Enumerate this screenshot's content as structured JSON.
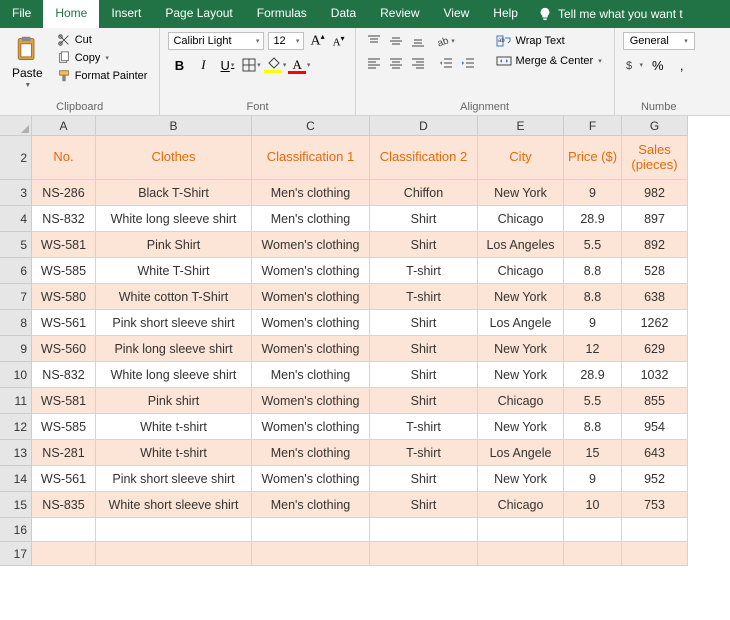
{
  "tabs": {
    "file": "File",
    "home": "Home",
    "insert": "Insert",
    "page_layout": "Page Layout",
    "formulas": "Formulas",
    "data": "Data",
    "review": "Review",
    "view": "View",
    "help": "Help",
    "tell_me": "Tell me what you want t"
  },
  "ribbon": {
    "clipboard": {
      "paste": "Paste",
      "cut": "Cut",
      "copy": "Copy",
      "format_painter": "Format Painter",
      "label": "Clipboard"
    },
    "font": {
      "name": "Calibri Light",
      "size": "12",
      "label": "Font"
    },
    "alignment": {
      "wrap": "Wrap Text",
      "merge": "Merge & Center",
      "label": "Alignment"
    },
    "number": {
      "format": "General",
      "label": "Numbe"
    }
  },
  "columns": [
    "A",
    "B",
    "C",
    "D",
    "E",
    "F",
    "G"
  ],
  "row_start": 2,
  "headers": {
    "no": "No.",
    "clothes": "Clothes",
    "c1": "Classification 1",
    "c2": "Classification 2",
    "city": "City",
    "price": "Price ($)",
    "sales": "Sales (pieces)"
  },
  "rows": [
    {
      "no": "NS-286",
      "clothes": "Black T-Shirt",
      "c1": "Men's clothing",
      "c2": "Chiffon",
      "city": "New York",
      "price": "9",
      "sales": "982"
    },
    {
      "no": "NS-832",
      "clothes": "White long sleeve shirt",
      "c1": "Men's clothing",
      "c2": "Shirt",
      "city": "Chicago",
      "price": "28.9",
      "sales": "897"
    },
    {
      "no": "WS-581",
      "clothes": "Pink Shirt",
      "c1": "Women's clothing",
      "c2": "Shirt",
      "city": "Los Angeles",
      "price": "5.5",
      "sales": "892"
    },
    {
      "no": "WS-585",
      "clothes": "White T-Shirt",
      "c1": "Women's clothing",
      "c2": "T-shirt",
      "city": "Chicago",
      "price": "8.8",
      "sales": "528"
    },
    {
      "no": "WS-580",
      "clothes": "White cotton T-Shirt",
      "c1": "Women's clothing",
      "c2": "T-shirt",
      "city": "New York",
      "price": "8.8",
      "sales": "638"
    },
    {
      "no": "WS-561",
      "clothes": "Pink short sleeve shirt",
      "c1": "Women's clothing",
      "c2": "Shirt",
      "city": "Los Angele",
      "price": "9",
      "sales": "1262"
    },
    {
      "no": "WS-560",
      "clothes": "Pink long sleeve shirt",
      "c1": "Women's clothing",
      "c2": "Shirt",
      "city": "New York",
      "price": "12",
      "sales": "629"
    },
    {
      "no": "NS-832",
      "clothes": "White long sleeve shirt",
      "c1": "Men's clothing",
      "c2": "Shirt",
      "city": "New York",
      "price": "28.9",
      "sales": "1032"
    },
    {
      "no": "WS-581",
      "clothes": "Pink shirt",
      "c1": "Women's clothing",
      "c2": "Shirt",
      "city": "Chicago",
      "price": "5.5",
      "sales": "855"
    },
    {
      "no": "WS-585",
      "clothes": "White t-shirt",
      "c1": "Women's clothing",
      "c2": "T-shirt",
      "city": "New York",
      "price": "8.8",
      "sales": "954"
    },
    {
      "no": "NS-281",
      "clothes": "White t-shirt",
      "c1": "Men's clothing",
      "c2": "T-shirt",
      "city": "Los Angele",
      "price": "15",
      "sales": "643"
    },
    {
      "no": "WS-561",
      "clothes": "Pink short sleeve shirt",
      "c1": "Women's clothing",
      "c2": "Shirt",
      "city": "New York",
      "price": "9",
      "sales": "952"
    },
    {
      "no": "NS-835",
      "clothes": "White short sleeve shirt",
      "c1": "Men's clothing",
      "c2": "Shirt",
      "city": "Chicago",
      "price": "10",
      "sales": "753"
    }
  ]
}
